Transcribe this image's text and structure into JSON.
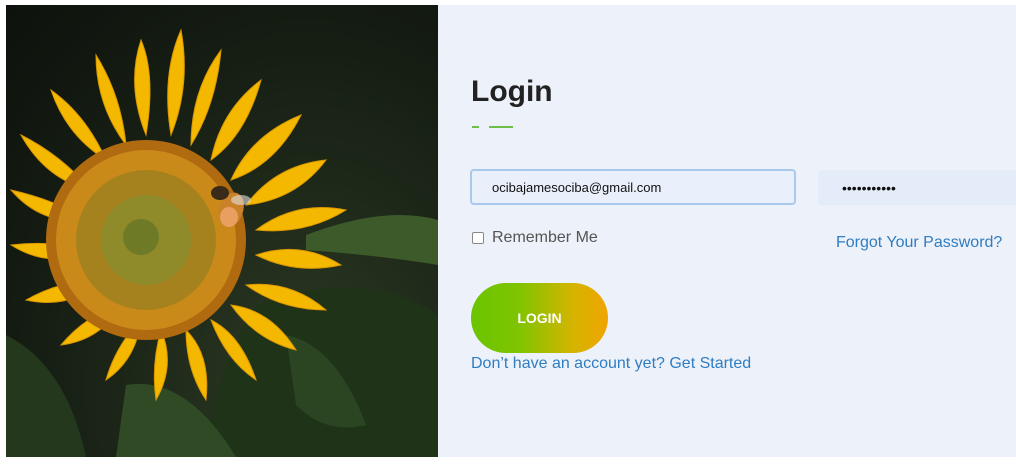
{
  "login": {
    "title": "Login",
    "email_value": "ocibajamesociba@gmail.com",
    "password_value": "•••••••••••",
    "remember_label": "Remember Me",
    "forgot_link": "Forgot Your Password?",
    "login_button": "LOGIN",
    "signup_link": "Don’t have an account yet? Get Started"
  },
  "colors": {
    "panel_bg": "#edf1f9",
    "accent_green": "#6cc04a",
    "link_blue": "#2f7dc2",
    "button_gradient_start": "#6bc400",
    "button_gradient_end": "#f0a400"
  },
  "hero_image": {
    "subject": "sunflower-with-bee"
  }
}
